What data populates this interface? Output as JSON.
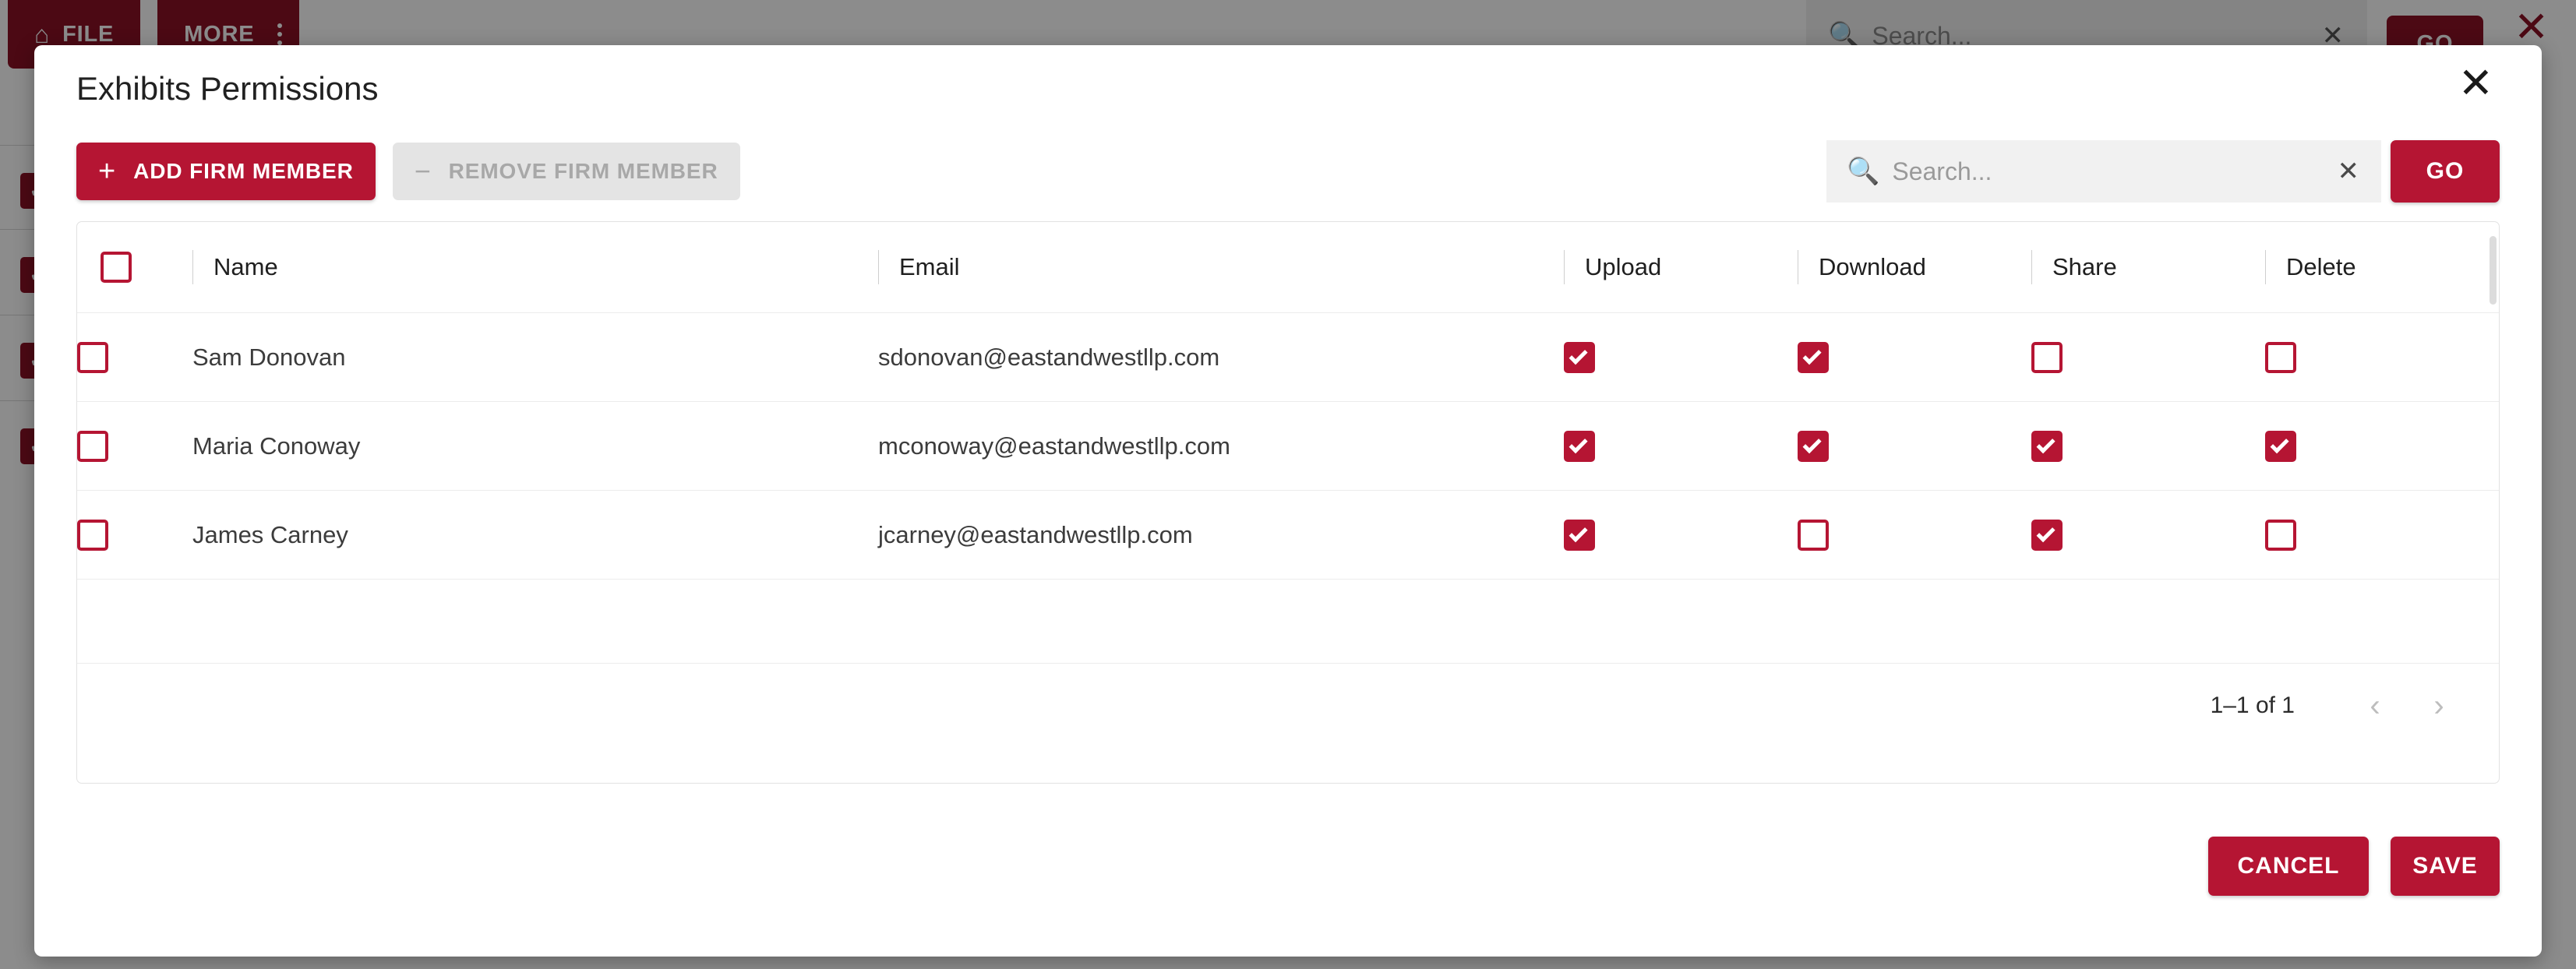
{
  "background": {
    "toolbar": {
      "file_label": "FILE",
      "home_icon": "home-icon",
      "more_label": "MORE",
      "kebab_icon": "more-vertical-icon"
    },
    "search": {
      "placeholder": "Search...",
      "search_icon": "search-icon",
      "clear_icon": "close-icon",
      "go_label": "GO"
    },
    "close_icon": "close-icon",
    "upload_icon": "upload-arrow-icon",
    "row_checkbox_icon": "checkbox-checked-icon"
  },
  "modal": {
    "title": "Exhibits Permissions",
    "close_icon": "close-icon",
    "actions": {
      "add_label": "ADD FIRM MEMBER",
      "add_icon": "plus-icon",
      "remove_label": "REMOVE FIRM MEMBER",
      "remove_icon": "minus-icon"
    },
    "search": {
      "placeholder": "Search...",
      "search_icon": "search-icon",
      "clear_icon": "close-icon",
      "go_label": "GO"
    },
    "table": {
      "columns": {
        "select": "",
        "name": "Name",
        "email": "Email",
        "upload": "Upload",
        "download": "Download",
        "share": "Share",
        "delete": "Delete"
      },
      "header_select_checked": false,
      "rows": [
        {
          "selected": false,
          "name": "Sam Donovan",
          "email": "sdonovan@eastandwestllp.com",
          "upload": true,
          "download": true,
          "share": false,
          "delete": false
        },
        {
          "selected": false,
          "name": "Maria Conoway",
          "email": "mconoway@eastandwestllp.com",
          "upload": true,
          "download": true,
          "share": true,
          "delete": true
        },
        {
          "selected": false,
          "name": "James Carney",
          "email": "jcarney@eastandwestllp.com",
          "upload": true,
          "download": false,
          "share": true,
          "delete": false
        }
      ]
    },
    "pagination": {
      "range_label": "1–1 of 1",
      "prev_icon": "chevron-left-icon",
      "next_icon": "chevron-right-icon",
      "prev_glyph": "‹",
      "next_glyph": "›"
    },
    "footer": {
      "cancel_label": "CANCEL",
      "save_label": "SAVE"
    }
  },
  "colors": {
    "brand_crimson": "#b51533",
    "brand_dark_maroon": "#8a1226",
    "disabled_grey": "#e4e4e4",
    "text_dark": "#212121"
  }
}
